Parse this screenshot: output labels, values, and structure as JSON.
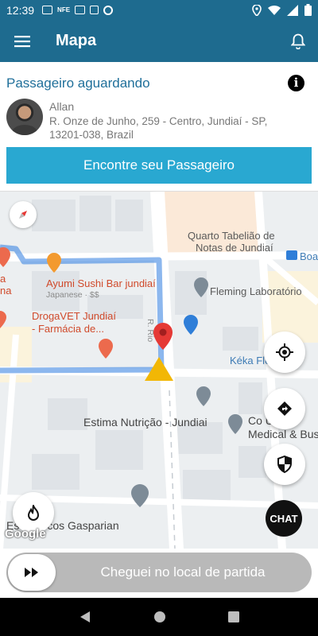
{
  "status_bar": {
    "time": "12:39",
    "left_icons": [
      "facebook-icon",
      "nfe-icon",
      "gallery-icon",
      "sd-card-icon",
      "vpn-icon"
    ],
    "right_icons": [
      "location-icon",
      "wifi-icon",
      "signal-icon",
      "battery-icon"
    ]
  },
  "app_bar": {
    "title": "Mapa",
    "menu_icon": "hamburger-menu-icon",
    "bell_icon": "bell-icon"
  },
  "passenger_card": {
    "title": "Passageiro aguardando",
    "name": "Allan",
    "address": "R. Onze de Junho, 259 - Centro, Jundiaí - SP, 13201-038, Brazil",
    "find_button": "Encontre seu Passageiro",
    "info_glyph": "i"
  },
  "map": {
    "labels": {
      "quarto_tabeliao": "Quarto Tabelião de",
      "notas_jundiai": "Notas de Jundiaí",
      "boa": "Boa",
      "ayumi": "Ayumi Sushi Bar jundiaí",
      "ayumi_sub": "Japanese · $$",
      "fleming": "Fleming Laboratório",
      "drogavet1": "DrogaVET Jundiaí",
      "drogavet2": "- Farmácia de...",
      "keka": "Kéka Flo",
      "estima": "Estima Nutrição - Jundiai",
      "comercio1": "Co         U",
      "medical": "Medical & Bus",
      "marcos": "Esc    Marcos Gasparian",
      "left_a": "a",
      "left_na": "na",
      "street_label": "R. Rio"
    },
    "google": "Google",
    "colors": {
      "route": "#7cb0ef",
      "pin": "#e53935",
      "arrow": "#f2b705",
      "poi_gray": "#7d8b97",
      "poi_blue": "#2f7ed8"
    }
  },
  "chat": {
    "label": "CHAT"
  },
  "slider": {
    "label": "Cheguei no local de partida"
  }
}
